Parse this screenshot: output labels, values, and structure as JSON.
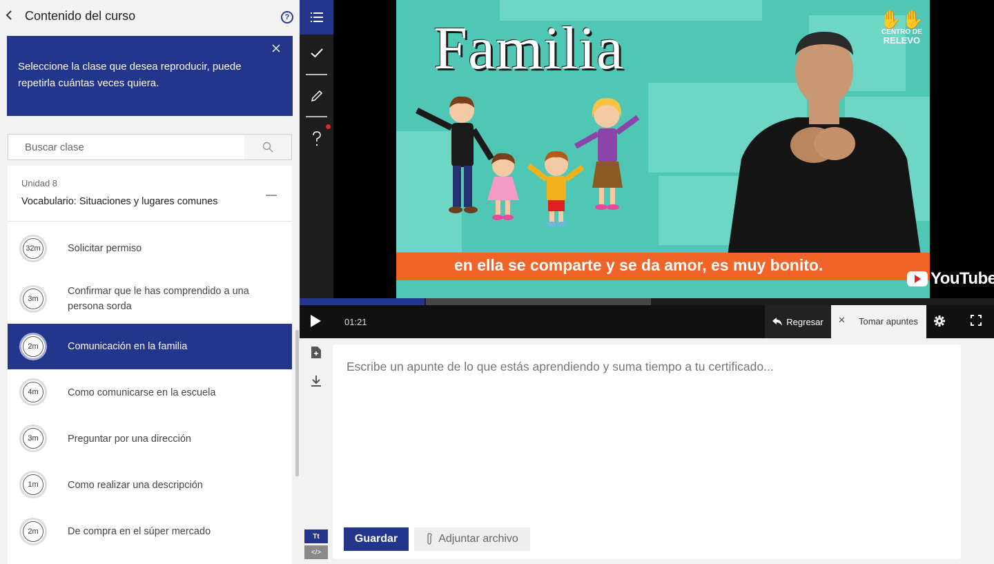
{
  "sidebar": {
    "title": "Contenido del curso",
    "help": "?",
    "notice": "Seleccione la clase que desea reproducir, puede repetirla cuántas veces quiera.",
    "search_placeholder": "Buscar clase",
    "unit": {
      "label": "Unidad 8",
      "title": "Vocabulario: Situaciones y lugares comunes"
    },
    "lessons": [
      {
        "duration": "32m",
        "name": "Solicitar permiso",
        "active": false
      },
      {
        "duration": "3m",
        "name": "Confirmar que le has comprendido a una persona sorda",
        "active": false
      },
      {
        "duration": "2m",
        "name": "Comunicación en la familia",
        "active": true
      },
      {
        "duration": "4m",
        "name": "Como comunicarse en la escuela",
        "active": false
      },
      {
        "duration": "3m",
        "name": "Preguntar por una dirección",
        "active": false
      },
      {
        "duration": "1m",
        "name": "Como realizar una descripción",
        "active": false
      },
      {
        "duration": "2m",
        "name": "De compra en el súper mercado",
        "active": false
      }
    ]
  },
  "rail": {
    "icons": [
      "list-icon",
      "check-icon",
      "pencil-icon",
      "question-icon"
    ]
  },
  "video": {
    "overlay_title": "Familia",
    "caption": "en ella se comparte y se da amor, es muy bonito.",
    "watermark_line1": "CENTRO DE",
    "watermark_line2": "RELEVO",
    "youtube": "YouTube",
    "current_time": "01:21",
    "progress": 0.18
  },
  "controls": {
    "regresar": "Regresar",
    "tomar_apuntes": "Tomar apuntes"
  },
  "notes": {
    "placeholder": "Escribe un apunte de lo que estás aprendiendo y suma tiempo a tu certificado...",
    "save": "Guardar",
    "attach": "Adjuntar archivo",
    "format_text": "Tt",
    "format_code": "</>"
  },
  "colors": {
    "brand": "#24358c",
    "caption_bar": "#f06428",
    "video_bg": "#4fc7b4"
  }
}
